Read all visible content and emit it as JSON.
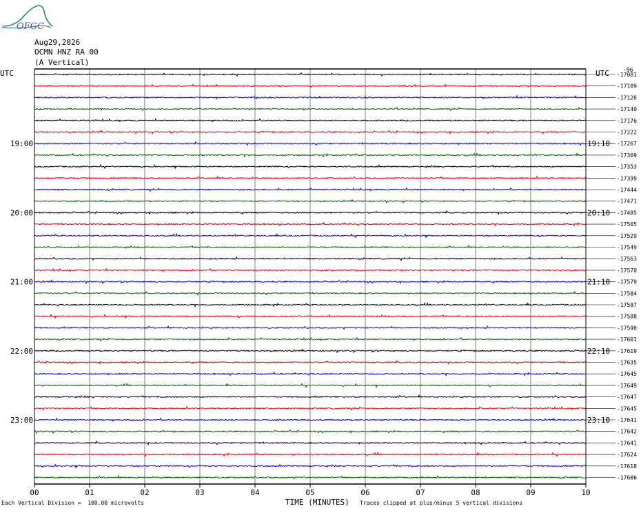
{
  "header": {
    "date": "Aug29,2026",
    "station": "OCMN HNZ RA 00",
    "component": "(A Vertical)",
    "utc_left": "UTC",
    "utc_right": "UTC",
    "logo_text": "OFGC"
  },
  "footer": {
    "vertical_division": "Each Vertical Division =  100.00 microvolts",
    "time_label": "TIME (MINUTES)",
    "clip_note": "Traces clipped at plus/minus 5 vertical divisions"
  },
  "colors": {
    "trace_cycle": [
      "#000000",
      "#e00000",
      "#0000e0",
      "#006400"
    ],
    "grid": "#808080",
    "frame": "#000000"
  },
  "chart_data": {
    "type": "line",
    "title": "",
    "xlabel": "TIME (MINUTES)",
    "ylabel": "",
    "x_ticks": [
      "00",
      "01",
      "02",
      "03",
      "04",
      "05",
      "06",
      "07",
      "08",
      "09",
      "10"
    ],
    "xlim": [
      0,
      10
    ],
    "grid": true,
    "left_hour_labels": [
      {
        "row": 6,
        "label": "19:00"
      },
      {
        "row": 12,
        "label": "20:00"
      },
      {
        "row": 18,
        "label": "21:00"
      },
      {
        "row": 24,
        "label": "22:00"
      },
      {
        "row": 30,
        "label": "23:00"
      }
    ],
    "right_hour_labels": [
      {
        "row": 6,
        "label": "19:10"
      },
      {
        "row": 12,
        "label": "20:10"
      },
      {
        "row": 18,
        "label": "21:10"
      },
      {
        "row": 24,
        "label": "22:10"
      },
      {
        "row": 30,
        "label": "23:10"
      }
    ],
    "right_top_marker": "-96",
    "trace_offsets": [
      "-17081",
      "-17109",
      "-17126",
      "-17140",
      "-17176",
      "-17222",
      "-17267",
      "-17309",
      "-17353",
      "-17399",
      "-17444",
      "-17471",
      "-17485",
      "-17505",
      "-17529",
      "-17549",
      "-17563",
      "-17570",
      "-17579",
      "-17584",
      "-17587",
      "-17588",
      "-17590",
      "-17601",
      "-17619",
      "-17635",
      "-17645",
      "-17649",
      "-17647",
      "-17645",
      "-17641",
      "-17642",
      "-17641",
      "-17624",
      "-17618",
      "-17606"
    ],
    "row_count": 36
  }
}
